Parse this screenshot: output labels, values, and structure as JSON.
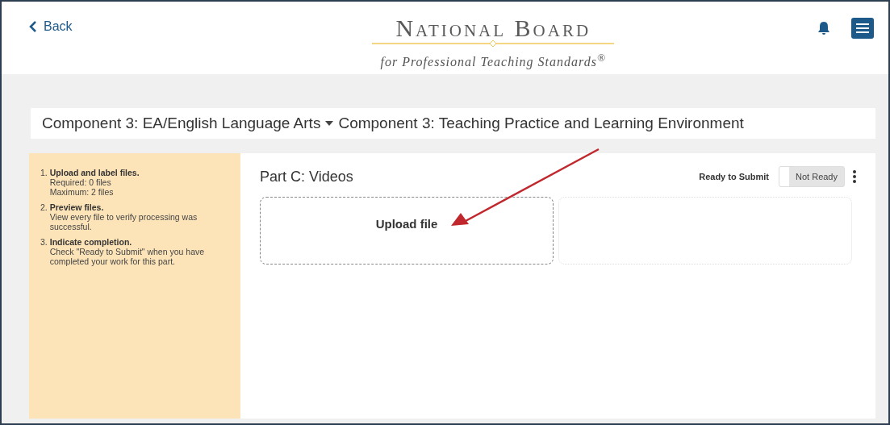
{
  "header": {
    "back": "Back",
    "logo_title": "National Board",
    "logo_subtitle": "for Professional Teaching Standards$^{®}$"
  },
  "breadcrumb": {
    "component": "Component 3: EA/English Language Arts",
    "page": "Component 3: Teaching Practice and Learning Environment"
  },
  "steps": [
    {
      "number": "1.",
      "title": "Upload and label files.",
      "lines": [
        "Required: 0 files",
        "Maximum: 2 files"
      ]
    },
    {
      "number": "2.",
      "title": "Preview files.",
      "lines": [
        "View every file to verify processing was successful."
      ]
    },
    {
      "number": "3.",
      "title": "Indicate completion.",
      "lines": [
        "Check \"Ready to Submit\" when you have completed your work for this part."
      ]
    }
  ],
  "part": {
    "title": "Part C: Videos",
    "ready_label": "Ready to Submit",
    "toggle": {
      "on": false,
      "label": "Not Ready"
    }
  },
  "slots": [
    {
      "kind": "upload",
      "label": "Upload file"
    },
    {
      "kind": "empty"
    }
  ]
}
